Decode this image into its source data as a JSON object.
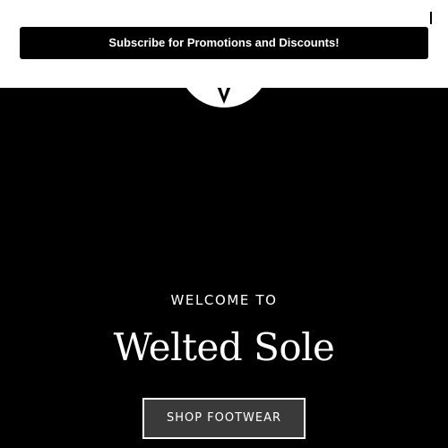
{
  "promo": {
    "subscribe_label": "Subscribe for Promotions and Discounts!",
    "close_icon": "close-icon"
  },
  "hero": {
    "welcome_text": "WELCOME TO",
    "brand_name": "Welted Sole",
    "shop_button_label": "SHOP FOOTWEAR"
  },
  "colors": {
    "background": "#000000",
    "popup_background": "#ffffff",
    "subscribe_button": "#000000",
    "shop_button_fill": "#3a3a3a",
    "text": "#ffffff"
  }
}
